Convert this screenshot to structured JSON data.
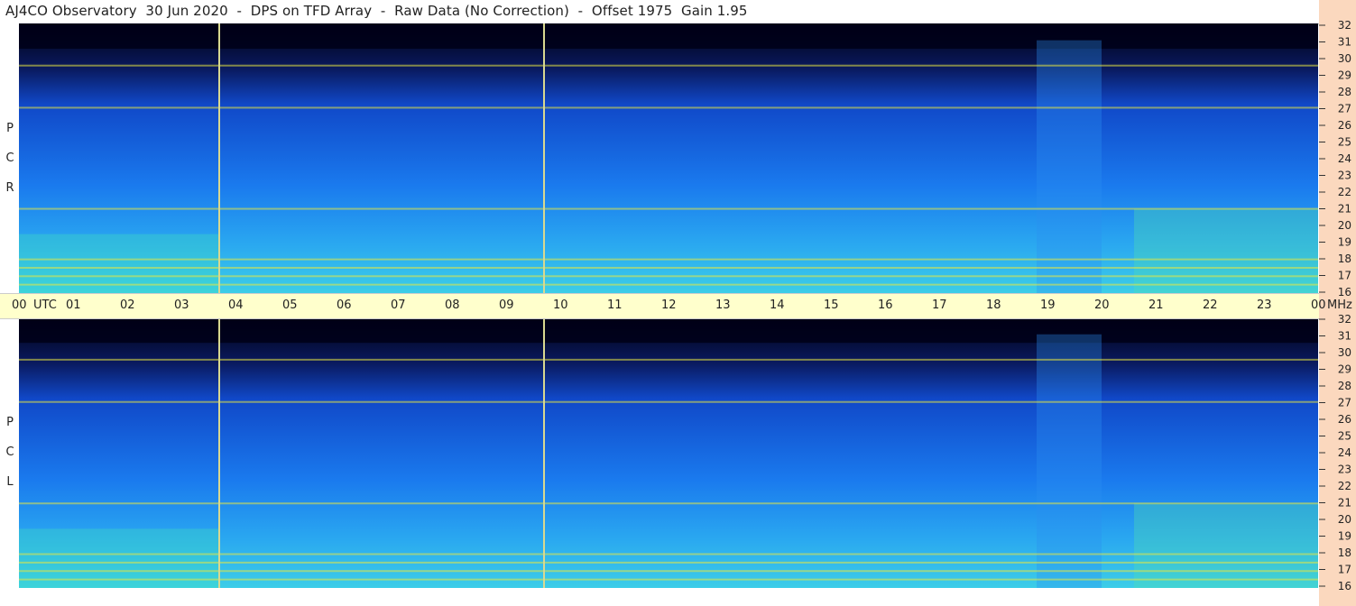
{
  "title": "AJ4CO Observatory  30 Jun 2020  -  DPS on TFD Array  -  Raw Data (No Correction)  -  Offset 1975  Gain 1.95",
  "colors": {
    "right_strip": "#fbd8be",
    "timebar": "#ffffcc",
    "night": "#000018",
    "low": "#0a2aa0",
    "mid": "#1a70e8",
    "high": "#40d0f0",
    "hot": "#f0f040"
  },
  "panels": [
    {
      "label_letters": [
        "R",
        "C",
        "P"
      ]
    },
    {
      "label_letters": [
        "L",
        "C",
        "P"
      ]
    }
  ],
  "time_axis": {
    "labels": [
      "00",
      "UTC",
      "01",
      "02",
      "03",
      "04",
      "05",
      "06",
      "07",
      "08",
      "09",
      "10",
      "11",
      "12",
      "13",
      "14",
      "15",
      "16",
      "17",
      "18",
      "19",
      "20",
      "21",
      "22",
      "23",
      "00",
      "MHz"
    ],
    "hours": [
      0,
      1,
      2,
      3,
      4,
      5,
      6,
      7,
      8,
      9,
      10,
      11,
      12,
      13,
      14,
      15,
      16,
      17,
      18,
      19,
      20,
      21,
      22,
      23,
      24
    ]
  },
  "chart_data": {
    "type": "heatmap",
    "title": "AJ4CO Observatory  30 Jun 2020  -  DPS on TFD Array  -  Raw Data (No Correction)  -  Offset 1975  Gain 1.95",
    "xlabel": "UTC",
    "ylabel": "MHz",
    "x_range": [
      0,
      24
    ],
    "y_range": [
      16,
      32
    ],
    "y_ticks": [
      16,
      17,
      18,
      19,
      20,
      21,
      22,
      23,
      24,
      25,
      26,
      27,
      28,
      29,
      30,
      31,
      32
    ],
    "series": [
      {
        "name": "RCP"
      },
      {
        "name": "LCP"
      }
    ],
    "vertical_markers_utc": [
      3.7,
      9.7
    ],
    "interference_bands_mhz": [
      16.5,
      17.0,
      17.5,
      18.0,
      21.0,
      27.0,
      29.5
    ]
  }
}
